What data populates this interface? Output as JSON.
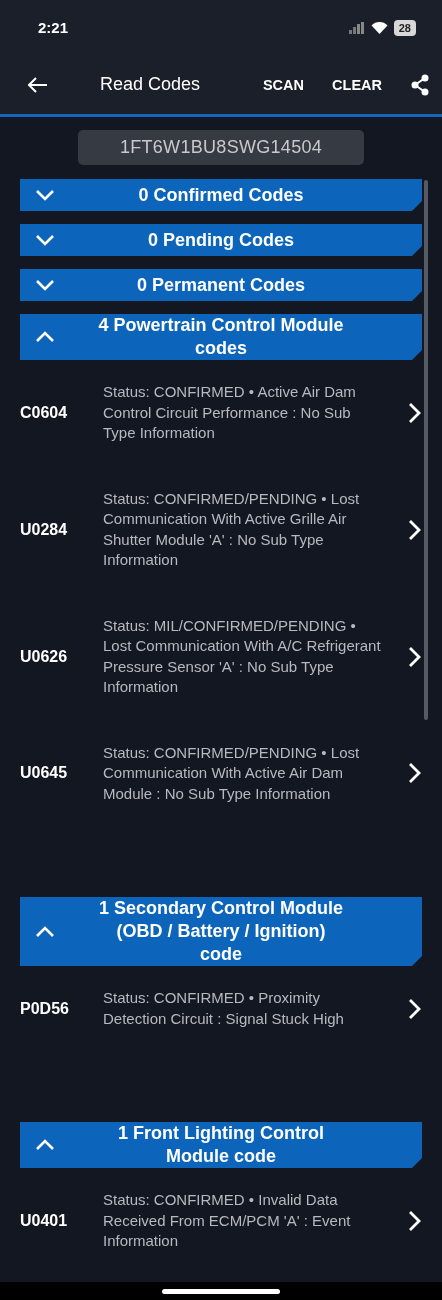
{
  "status_bar": {
    "time": "2:21",
    "battery": "28"
  },
  "app_bar": {
    "title": "Read Codes",
    "actions": [
      "SCAN",
      "CLEAR"
    ]
  },
  "vin": "1FT6W1BU8SWG14504",
  "sections": [
    {
      "title": "0 Confirmed Codes",
      "expanded": false
    },
    {
      "title": "0 Pending Codes",
      "expanded": false
    },
    {
      "title": "0 Permanent Codes",
      "expanded": false
    },
    {
      "title": "4 Powertrain Control Module codes",
      "expanded": true,
      "codes": [
        {
          "code": "C0604",
          "description": "Status: CONFIRMED • Active Air Dam Control Circuit Performance : No Sub Type Information"
        },
        {
          "code": "U0284",
          "description": "Status: CONFIRMED/PENDING • Lost Communication With Active Grille Air Shutter Module 'A' : No Sub Type Information"
        },
        {
          "code": "U0626",
          "description": "Status: MIL/CONFIRMED/PENDING • Lost Communication With A/C Refrigerant Pressure Sensor 'A' : No Sub Type Information"
        },
        {
          "code": "U0645",
          "description": "Status: CONFIRMED/PENDING • Lost Communication With Active Air Dam Module : No Sub Type Information"
        }
      ]
    },
    {
      "title": "1 Secondary Control Module (OBD / Battery / Ignition) code",
      "expanded": true,
      "codes": [
        {
          "code": "P0D56",
          "description": "Status: CONFIRMED • Proximity Detection Circuit : Signal Stuck High"
        }
      ]
    },
    {
      "title": "1 Front Lighting Control Module code",
      "expanded": true,
      "codes": [
        {
          "code": "U0401",
          "description": "Status: CONFIRMED • Invalid Data Received From ECM/PCM 'A' : Event Information"
        }
      ]
    }
  ]
}
